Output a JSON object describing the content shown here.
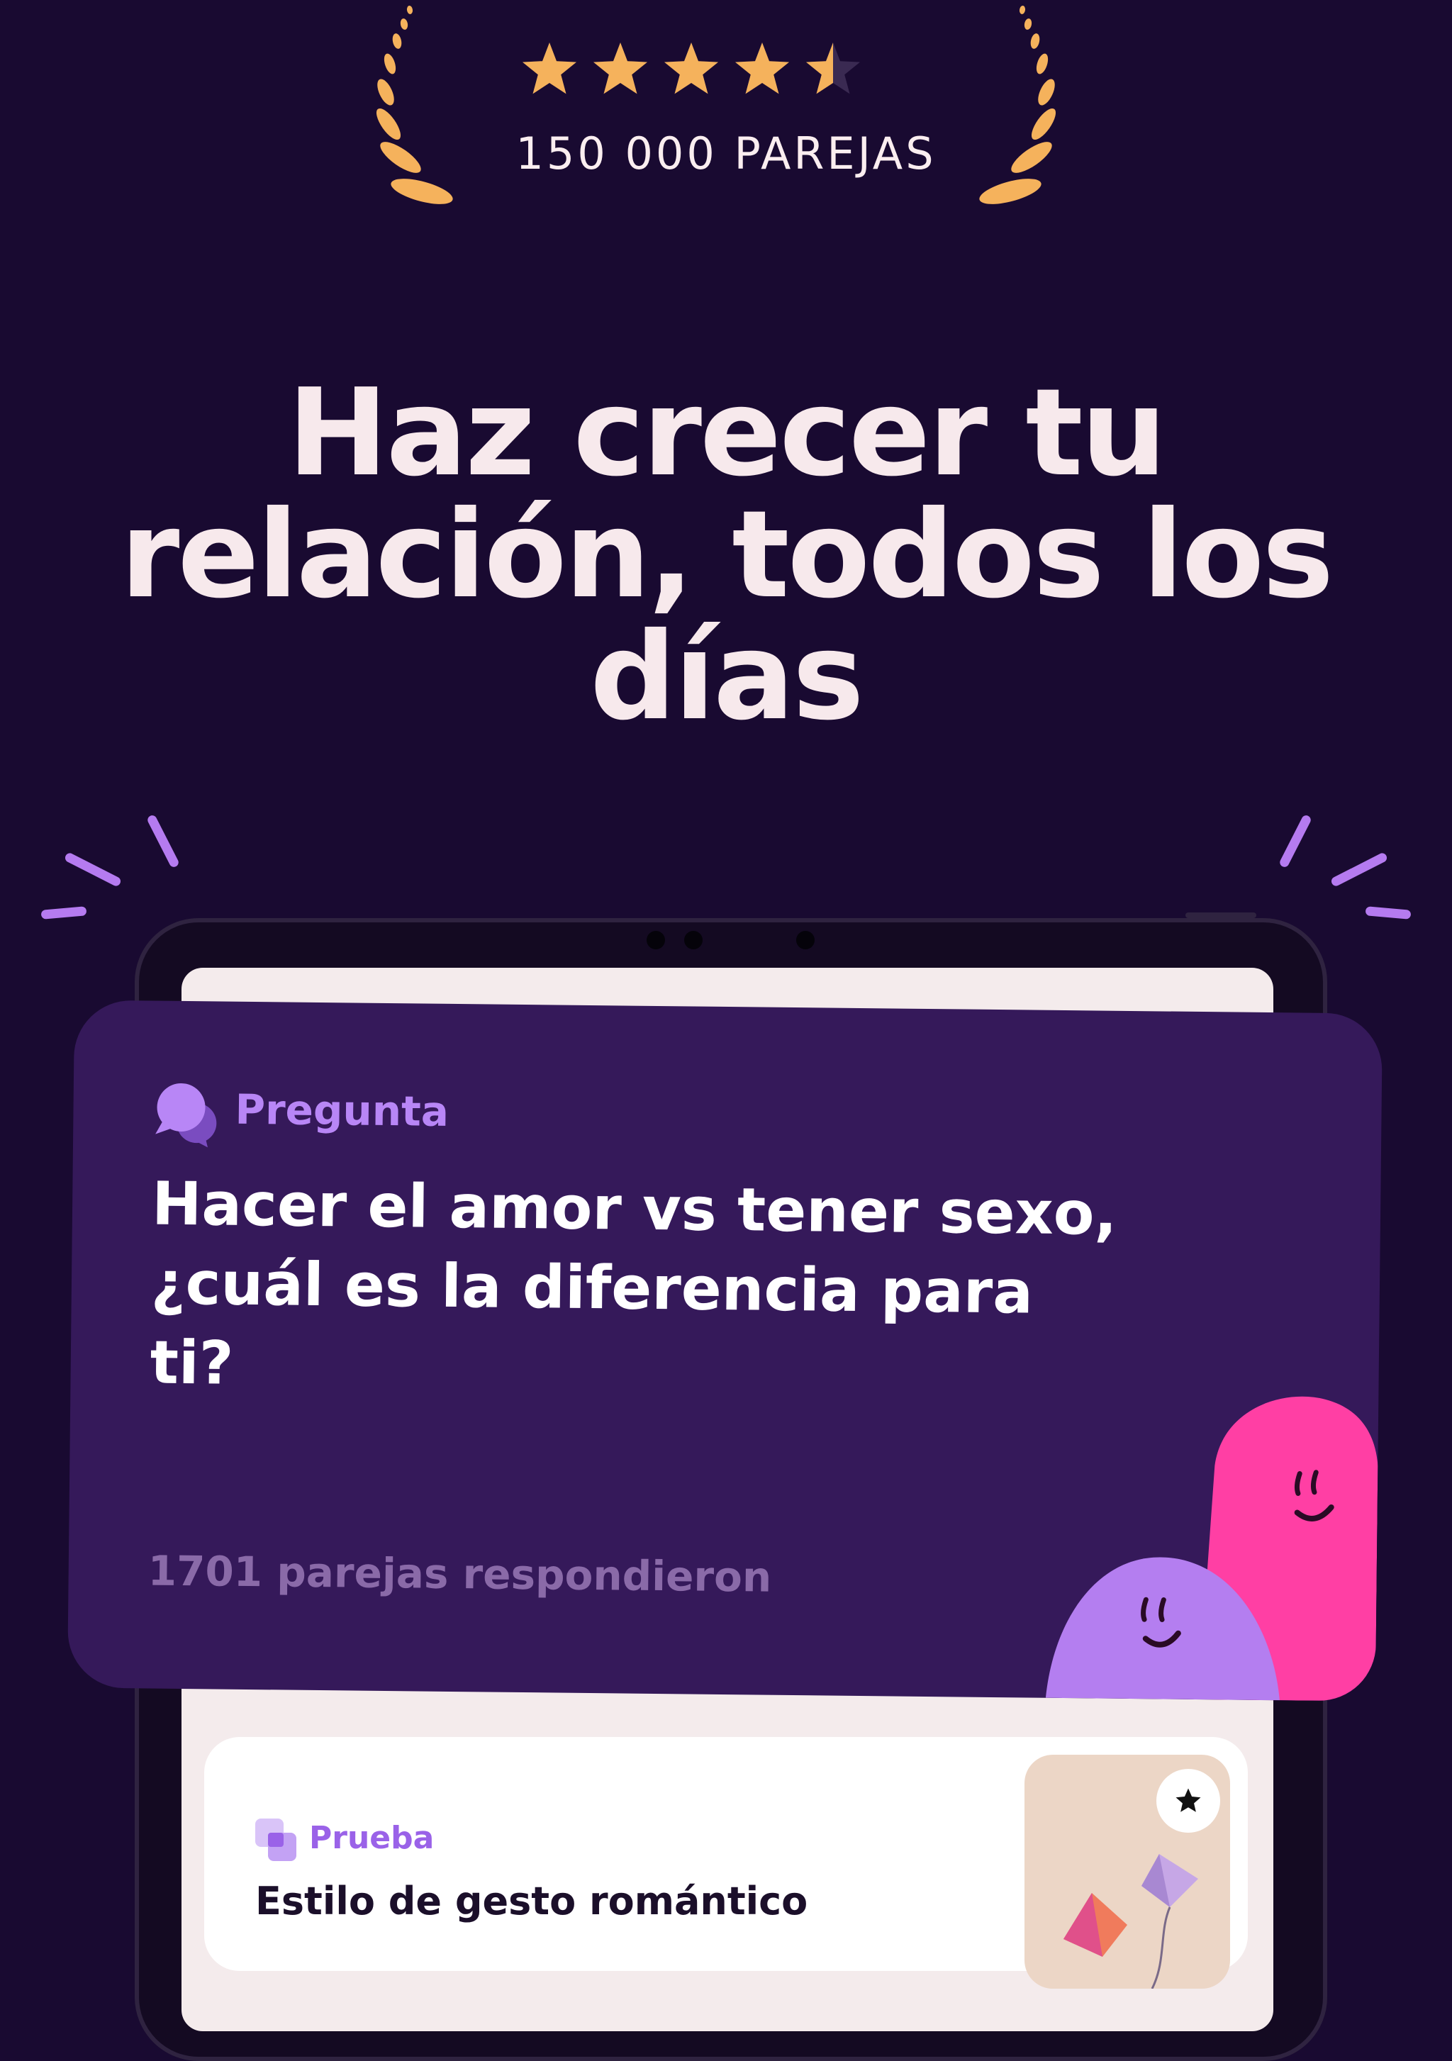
{
  "rating": {
    "stars_value": 4.5,
    "stars_max": 5,
    "label": "150 000 PAREJAS",
    "star_color": "#f5b25c",
    "laurel_color": "#f5b25c"
  },
  "headline": {
    "line1": "Haz crecer tu",
    "line2": "relación, todos los",
    "line3": "días"
  },
  "question_card": {
    "tag_icon": "chat-bubbles-icon",
    "tag": "Pregunta",
    "question_line1": "Hacer el amor vs tener sexo,",
    "question_line2": "¿cuál es la diferencia para",
    "question_line3": "ti?",
    "responses": "1701 parejas respondieron"
  },
  "test_card": {
    "tag_icon": "layers-icon",
    "tag": "Prueba",
    "title": "Estilo de gesto romántico",
    "favorite_icon": "star-icon"
  },
  "colors": {
    "background": "#190a31",
    "card": "#35195a",
    "accent": "#b886f6",
    "mascot_pink": "#ff3fa4",
    "mascot_purple": "#b47ef0"
  }
}
